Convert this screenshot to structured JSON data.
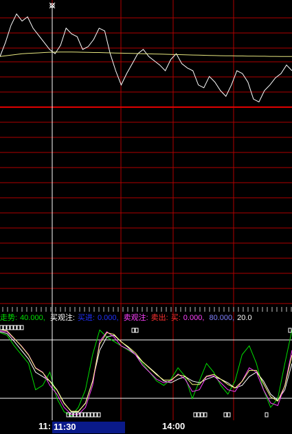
{
  "colors": {
    "background": "#000000",
    "grid": "#c00000",
    "price_line": "#ffffff",
    "avg_line": "#e8e880",
    "cursor": "#ffffff",
    "trend": "#00e000",
    "buy_watch": "#ffffff",
    "sell_watch": "#ff40ff",
    "level_line": "#ffffff"
  },
  "cursor": {
    "marker_icon": "crosshair-marker-icon",
    "time_left_label": "11:",
    "time_value": "11:30"
  },
  "indicator_legend": {
    "trend_label": "走势:",
    "trend_value": "40.000,",
    "buy_label": "买观注:",
    "buy_value_label": "买进:",
    "buy_value": "0.000,",
    "sell_label": "卖观注:",
    "out_label": "卖出:",
    "out_sub": "买:",
    "out_value": "0.000,",
    "level_80": "80.000,",
    "level_20": "20.0"
  },
  "time_axis": {
    "label_1400": "14:00"
  },
  "chart_data": {
    "type": "line",
    "panels": [
      {
        "name": "price",
        "series": [
          {
            "values": [
              50,
              60,
              72,
              80,
              75,
              78,
              70,
              65,
              60,
              55,
              52,
              58,
              70,
              66,
              64,
              55,
              57,
              62,
              70,
              68,
              52,
              40,
              30,
              38,
              45,
              52,
              55,
              50,
              47,
              44,
              40,
              48,
              52,
              45,
              42,
              40,
              30,
              28,
              36,
              32,
              26,
              22,
              30,
              40,
              38,
              32,
              20,
              18,
              26,
              30,
              35,
              38,
              44,
              40
            ]
          },
          {
            "values": [
              50,
              50.5,
              51,
              51.5,
              52,
              52.2,
              52.4,
              52.6,
              52.8,
              53,
              53.1,
              53.2,
              53.2,
              53.2,
              53.1,
              53,
              52.9,
              52.8,
              52.8,
              52.7,
              52.6,
              52.5,
              52.4,
              52.3,
              52.2,
              52.1,
              52,
              51.9,
              51.8,
              51.7,
              51.6,
              51.5,
              51.4,
              51.3,
              51.2,
              51.1,
              51,
              50.9,
              50.8,
              50.7,
              50.6,
              50.5,
              50.5,
              50.4,
              50.4,
              50.3,
              50.3,
              50.2,
              50.2,
              50.1,
              50.1,
              50,
              50,
              50
            ]
          }
        ]
      },
      {
        "name": "oscillator",
        "series": [
          {
            "name": "走势",
            "values": [
              95,
              92,
              80,
              70,
              60,
              30,
              35,
              50,
              20,
              5,
              0,
              10,
              30,
              70,
              98,
              90,
              85,
              80,
              75,
              70,
              60,
              50,
              40,
              35,
              42,
              55,
              45,
              20,
              40,
              60,
              50,
              35,
              25,
              40,
              70,
              80,
              60,
              30,
              10,
              20,
              60,
              98
            ]
          },
          {
            "name": "买观注",
            "values": [
              96,
              94,
              85,
              75,
              65,
              50,
              45,
              40,
              30,
              15,
              5,
              5,
              15,
              40,
              75,
              90,
              92,
              85,
              78,
              70,
              62,
              55,
              48,
              40,
              38,
              42,
              45,
              40,
              38,
              42,
              45,
              42,
              38,
              32,
              35,
              45,
              50,
              40,
              25,
              18,
              30,
              60
            ]
          },
          {
            "name": "卖观注",
            "values": [
              97,
              96,
              88,
              80,
              70,
              55,
              50,
              35,
              25,
              10,
              2,
              2,
              10,
              35,
              85,
              96,
              90,
              80,
              76,
              70,
              58,
              50,
              42,
              38,
              40,
              48,
              42,
              28,
              30,
              45,
              46,
              38,
              30,
              28,
              40,
              55,
              50,
              30,
              15,
              12,
              35,
              75
            ]
          }
        ],
        "reference_lines": [
          80,
          20
        ]
      }
    ]
  }
}
